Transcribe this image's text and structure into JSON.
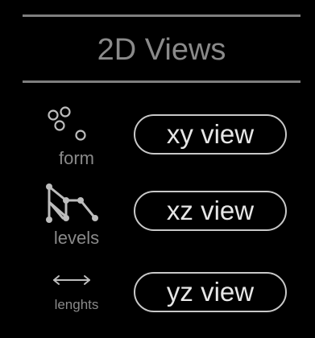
{
  "panel": {
    "title": "2D Views"
  },
  "rows": [
    {
      "icon": "circles-icon",
      "label": "form",
      "button": "xy view"
    },
    {
      "icon": "hierarchy-icon",
      "label": "levels",
      "button": "xz view"
    },
    {
      "icon": "double-arrow-icon",
      "label": "lenghts",
      "button": "yz view"
    }
  ],
  "colors": {
    "background": "#000000",
    "divider": "#7e7e7e",
    "title_text": "#8a8a8a",
    "button_border": "#c8c8c8",
    "button_text": "#e6e6e6"
  }
}
